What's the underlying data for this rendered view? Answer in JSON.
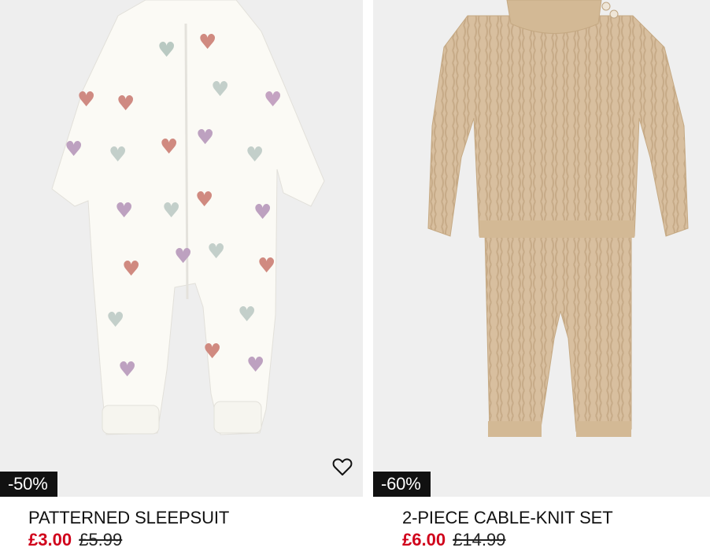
{
  "products": [
    {
      "badge": "-50%",
      "title": "PATTERNED SLEEPSUIT",
      "price_now": "£3.00",
      "price_was": "£5.99",
      "favorite_icon": "heart-outline-icon"
    },
    {
      "badge": "-60%",
      "title": "2-PIECE CABLE-KNIT SET",
      "price_now": "£6.00",
      "price_was": "£14.99",
      "favorite_icon": "heart-outline-icon"
    }
  ],
  "colors": {
    "sale_price": "#d0021b",
    "badge_bg": "#111111",
    "image_bg": "#eeeeee"
  }
}
